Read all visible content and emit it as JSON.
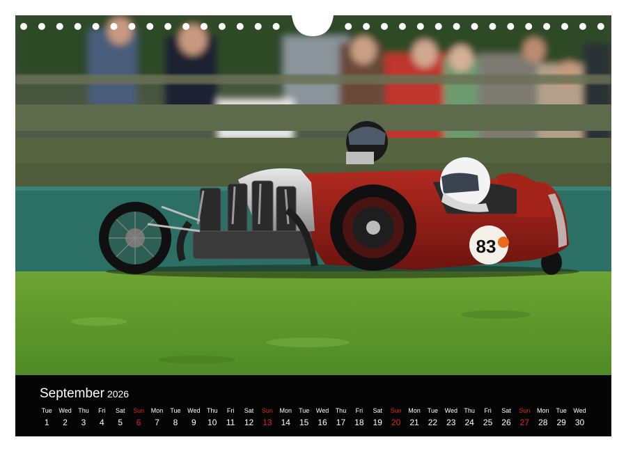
{
  "calendar": {
    "month": "September",
    "year": "2026",
    "days": [
      {
        "dow": "Tue",
        "num": "1"
      },
      {
        "dow": "Wed",
        "num": "2"
      },
      {
        "dow": "Thu",
        "num": "3"
      },
      {
        "dow": "Fri",
        "num": "4"
      },
      {
        "dow": "Sat",
        "num": "5"
      },
      {
        "dow": "Sun",
        "num": "6",
        "sunday": true
      },
      {
        "dow": "Mon",
        "num": "7"
      },
      {
        "dow": "Tue",
        "num": "8"
      },
      {
        "dow": "Wed",
        "num": "9"
      },
      {
        "dow": "Thu",
        "num": "10"
      },
      {
        "dow": "Fri",
        "num": "11"
      },
      {
        "dow": "Sat",
        "num": "12"
      },
      {
        "dow": "Sun",
        "num": "13",
        "sunday": true
      },
      {
        "dow": "Mon",
        "num": "14"
      },
      {
        "dow": "Tue",
        "num": "15"
      },
      {
        "dow": "Wed",
        "num": "16"
      },
      {
        "dow": "Thu",
        "num": "17"
      },
      {
        "dow": "Fri",
        "num": "18"
      },
      {
        "dow": "Sat",
        "num": "19"
      },
      {
        "dow": "Sun",
        "num": "20",
        "sunday": true
      },
      {
        "dow": "Mon",
        "num": "21"
      },
      {
        "dow": "Tue",
        "num": "22"
      },
      {
        "dow": "Wed",
        "num": "23"
      },
      {
        "dow": "Thu",
        "num": "24"
      },
      {
        "dow": "Fri",
        "num": "25"
      },
      {
        "dow": "Sat",
        "num": "26"
      },
      {
        "dow": "Sun",
        "num": "27",
        "sunday": true
      },
      {
        "dow": "Mon",
        "num": "28"
      },
      {
        "dow": "Tue",
        "num": "29"
      },
      {
        "dow": "Wed",
        "num": "30"
      }
    ]
  },
  "photo": {
    "race_number": "83"
  },
  "colors": {
    "calendar_bg": "#050505",
    "sunday": "#e32222",
    "car_body": "#8e1b14",
    "grass": "#5f9a2e"
  }
}
